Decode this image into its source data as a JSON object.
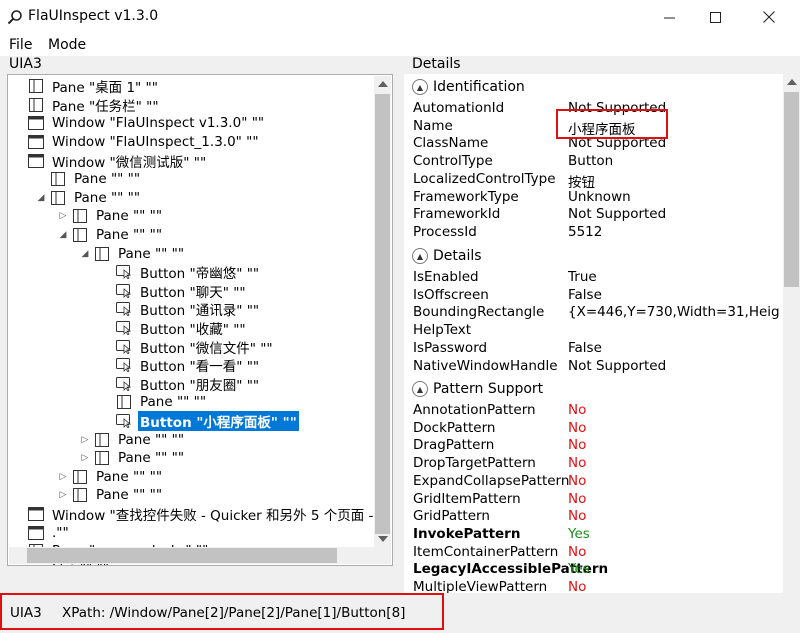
{
  "window": {
    "title": "FlaUInspect v1.3.0",
    "controls": [
      "minimize-icon",
      "maximize-icon",
      "close-icon"
    ]
  },
  "menu": {
    "items": [
      "File",
      "Mode"
    ]
  },
  "tree_panel": {
    "header": "UIA3",
    "nodes": [
      {
        "label": "Pane \"桌面 1\" \"\"",
        "icon": "pane-icon",
        "expander": "none"
      },
      {
        "label": "Pane \"任务栏\" \"\"",
        "icon": "pane-icon",
        "expander": "none"
      },
      {
        "label": "Window \"FlaUInspect v1.3.0\" \"\"",
        "icon": "window-icon",
        "expander": "none"
      },
      {
        "label": "Window \"FlaUInspect_1.3.0\" \"\"",
        "icon": "window-icon",
        "expander": "none"
      },
      {
        "label": "Window \"微信测试版\" \"\"",
        "icon": "window-icon",
        "expander": "none"
      },
      {
        "label": "Pane \"\" \"\"",
        "icon": "pane-icon",
        "expander": "none"
      },
      {
        "label": "Pane \"\" \"\"",
        "icon": "pane-icon",
        "expander": "expanded"
      },
      {
        "label": "Pane \"\" \"\"",
        "icon": "pane-icon",
        "expander": "collapsed"
      },
      {
        "label": "Pane \"\" \"\"",
        "icon": "pane-icon",
        "expander": "expanded"
      },
      {
        "label": "Pane \"\" \"\"",
        "icon": "pane-icon",
        "expander": "expanded"
      },
      {
        "label": "Button \"帝幽悠\" \"\"",
        "icon": "button-icon",
        "expander": "none"
      },
      {
        "label": "Button \"聊天\" \"\"",
        "icon": "button-icon",
        "expander": "none"
      },
      {
        "label": "Button \"通讯录\" \"\"",
        "icon": "button-icon",
        "expander": "none"
      },
      {
        "label": "Button \"收藏\" \"\"",
        "icon": "button-icon",
        "expander": "none"
      },
      {
        "label": "Button \"微信文件\" \"\"",
        "icon": "button-icon",
        "expander": "none"
      },
      {
        "label": "Button \"看一看\" \"\"",
        "icon": "button-icon",
        "expander": "none"
      },
      {
        "label": "Button \"朋友圈\" \"\"",
        "icon": "button-icon",
        "expander": "none"
      },
      {
        "label": "Pane \"\" \"\"",
        "icon": "pane-icon",
        "expander": "none"
      },
      {
        "label": "Button \"小程序面板\" \"\"",
        "icon": "button-icon",
        "expander": "none",
        "selected": true
      },
      {
        "label": "Pane \"\" \"\"",
        "icon": "pane-icon",
        "expander": "collapsed"
      },
      {
        "label": "Pane \"\" \"\"",
        "icon": "pane-icon",
        "expander": "collapsed"
      },
      {
        "label": "Pane \"\" \"\"",
        "icon": "pane-icon",
        "expander": "collapsed"
      },
      {
        "label": "Pane \"\" \"\"",
        "icon": "pane-icon",
        "expander": "collapsed"
      },
      {
        "label": "Window \"查找控件失败 - Quicker 和另外 5 个页面 -",
        "icon": "window-icon",
        "expander": "none"
      },
      {
        "label": ".\"\"",
        "icon": "window-icon",
        "expander": "none"
      },
      {
        "label": "Pane \"_name_desk_\" \"\"",
        "icon": "pane-icon",
        "expander": "none"
      },
      {
        "label": "List \"\" \"\"",
        "icon": "list-icon",
        "expander": "none"
      }
    ]
  },
  "details_panel": {
    "header": "Details",
    "identification": {
      "title": "Identification",
      "rows": [
        {
          "key": "AutomationId",
          "value": "Not Supported"
        },
        {
          "key": "Name",
          "value": "小程序面板"
        },
        {
          "key": "ClassName",
          "value": "Not Supported"
        },
        {
          "key": "ControlType",
          "value": "Button"
        },
        {
          "key": "LocalizedControlType",
          "value": "按钮"
        },
        {
          "key": "FrameworkType",
          "value": "Unknown"
        },
        {
          "key": "FrameworkId",
          "value": "Not Supported"
        },
        {
          "key": "ProcessId",
          "value": "5512"
        }
      ]
    },
    "details": {
      "title": "Details",
      "rows": [
        {
          "key": "IsEnabled",
          "value": "True"
        },
        {
          "key": "IsOffscreen",
          "value": "False"
        },
        {
          "key": "BoundingRectangle",
          "value": "{X=446,Y=730,Width=31,Heig"
        },
        {
          "key": "HelpText",
          "value": ""
        },
        {
          "key": "IsPassword",
          "value": "False"
        },
        {
          "key": "NativeWindowHandle",
          "value": "Not Supported"
        }
      ]
    },
    "patterns": {
      "title": "Pattern Support",
      "rows": [
        {
          "key": "AnnotationPattern",
          "value": "No"
        },
        {
          "key": "DockPattern",
          "value": "No"
        },
        {
          "key": "DragPattern",
          "value": "No"
        },
        {
          "key": "DropTargetPattern",
          "value": "No"
        },
        {
          "key": "ExpandCollapsePattern",
          "value": "No"
        },
        {
          "key": "GridItemPattern",
          "value": "No"
        },
        {
          "key": "GridPattern",
          "value": "No"
        },
        {
          "key": "InvokePattern",
          "value": "Yes",
          "bold": true
        },
        {
          "key": "ItemContainerPattern",
          "value": "No"
        },
        {
          "key": "LegacyIAccessiblePattern",
          "value": "Yes",
          "bold": true
        },
        {
          "key": "MultipleViewPattern",
          "value": "No"
        }
      ]
    }
  },
  "statusbar": {
    "mode": "UIA3",
    "xpath": "XPath:  /Window/Pane[2]/Pane[2]/Pane[1]/Button[8]"
  },
  "colors": {
    "selection": "#0078d7",
    "no": "#e01010",
    "yes": "#1e8a1e",
    "annotation_box": "#e01010"
  }
}
